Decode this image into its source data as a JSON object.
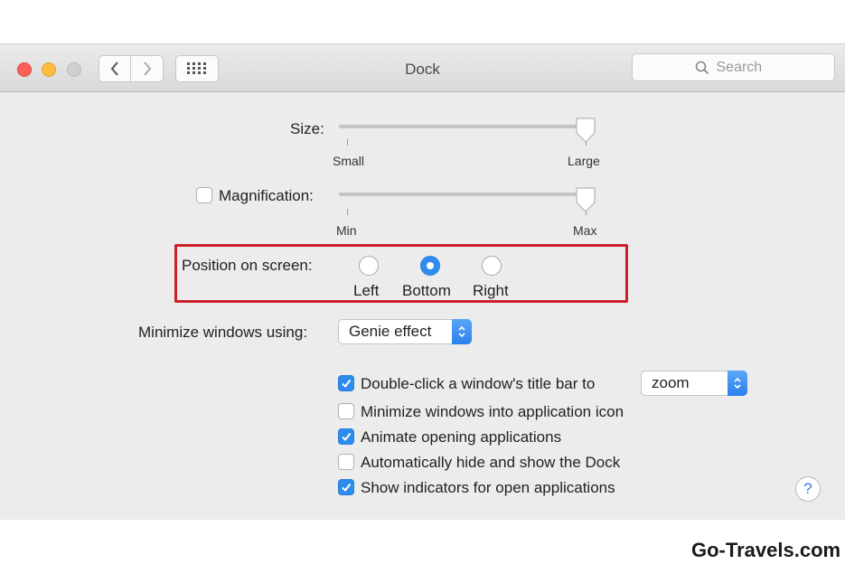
{
  "window": {
    "title": "Dock",
    "search_placeholder": "Search"
  },
  "size": {
    "label": "Size:",
    "min_label": "Small",
    "max_label": "Large",
    "level": 1.0
  },
  "magnification": {
    "label": "Magnification:",
    "checked": false,
    "min_label": "Min",
    "max_label": "Max",
    "level": 1.0
  },
  "position": {
    "label": "Position on screen:",
    "options": [
      "Left",
      "Bottom",
      "Right"
    ],
    "selected": "Bottom"
  },
  "minimize": {
    "label": "Minimize windows using:",
    "value": "Genie effect"
  },
  "checkboxes": [
    {
      "label": "Double-click a window's title bar to",
      "checked": true
    },
    {
      "label": "Minimize windows into application icon",
      "checked": false
    },
    {
      "label": "Animate opening applications",
      "checked": true
    },
    {
      "label": "Automatically hide and show the Dock",
      "checked": false
    },
    {
      "label": "Show indicators for open applications",
      "checked": true
    }
  ],
  "double_click_action": {
    "value": "zoom"
  },
  "help": {
    "label": "?"
  },
  "watermark": {
    "text": "Go-Travels.com"
  },
  "colors": {
    "accent": "#2e8cf0",
    "highlight_box": "#cc1f2a"
  }
}
